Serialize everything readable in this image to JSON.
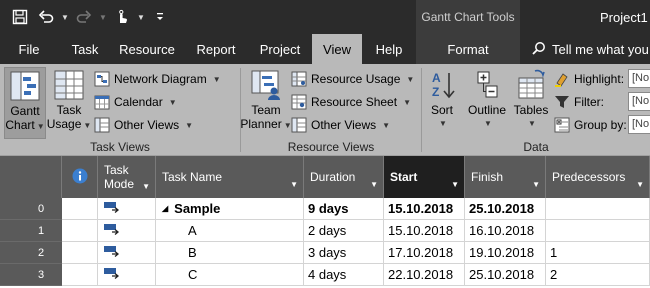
{
  "titlebar": {
    "context_title": "Gantt Chart Tools",
    "project_title": "Project1"
  },
  "tabs": [
    "File",
    "Task",
    "Resource",
    "Report",
    "Project",
    "View",
    "Help",
    "Format"
  ],
  "active_tab": "View",
  "tellme": "Tell me what you",
  "ribbon": {
    "task_views": {
      "label": "Task Views",
      "gantt": [
        "Gantt",
        "Chart"
      ],
      "task_usage": [
        "Task",
        "Usage"
      ],
      "network_diagram": "Network Diagram",
      "calendar": "Calendar",
      "other_views": "Other Views"
    },
    "resource_views": {
      "label": "Resource Views",
      "team_planner": [
        "Team",
        "Planner"
      ],
      "resource_usage": "Resource Usage",
      "resource_sheet": "Resource Sheet",
      "other_views": "Other Views"
    },
    "data": {
      "label": "Data",
      "sort": "Sort",
      "outline": "Outline",
      "tables": "Tables",
      "highlight": "Highlight:",
      "filter": "Filter:",
      "group_by": "Group by:",
      "field_value": "[No"
    }
  },
  "grid": {
    "headers": {
      "task_mode": [
        "Task",
        "Mode"
      ],
      "task_name": "Task Name",
      "duration": "Duration",
      "start": "Start",
      "finish": "Finish",
      "predecessors": "Predecessors"
    },
    "rows": [
      {
        "id": "0",
        "name": "Sample",
        "duration": "9 days",
        "start": "15.10.2018",
        "finish": "25.10.2018",
        "pred": "",
        "summary": true
      },
      {
        "id": "1",
        "name": "A",
        "duration": "2 days",
        "start": "15.10.2018",
        "finish": "16.10.2018",
        "pred": "",
        "summary": false
      },
      {
        "id": "2",
        "name": "B",
        "duration": "3 days",
        "start": "17.10.2018",
        "finish": "19.10.2018",
        "pred": "1",
        "summary": false
      },
      {
        "id": "3",
        "name": "C",
        "duration": "4 days",
        "start": "22.10.2018",
        "finish": "25.10.2018",
        "pred": "2",
        "summary": false
      }
    ]
  },
  "colors": {
    "titlebar": "#2b2b2b",
    "ribbon": "#b9b9b9",
    "grid_header": "#5a5a5a",
    "sorted_header": "#1f1f1f",
    "mode_icon": "#2e5c9e"
  }
}
